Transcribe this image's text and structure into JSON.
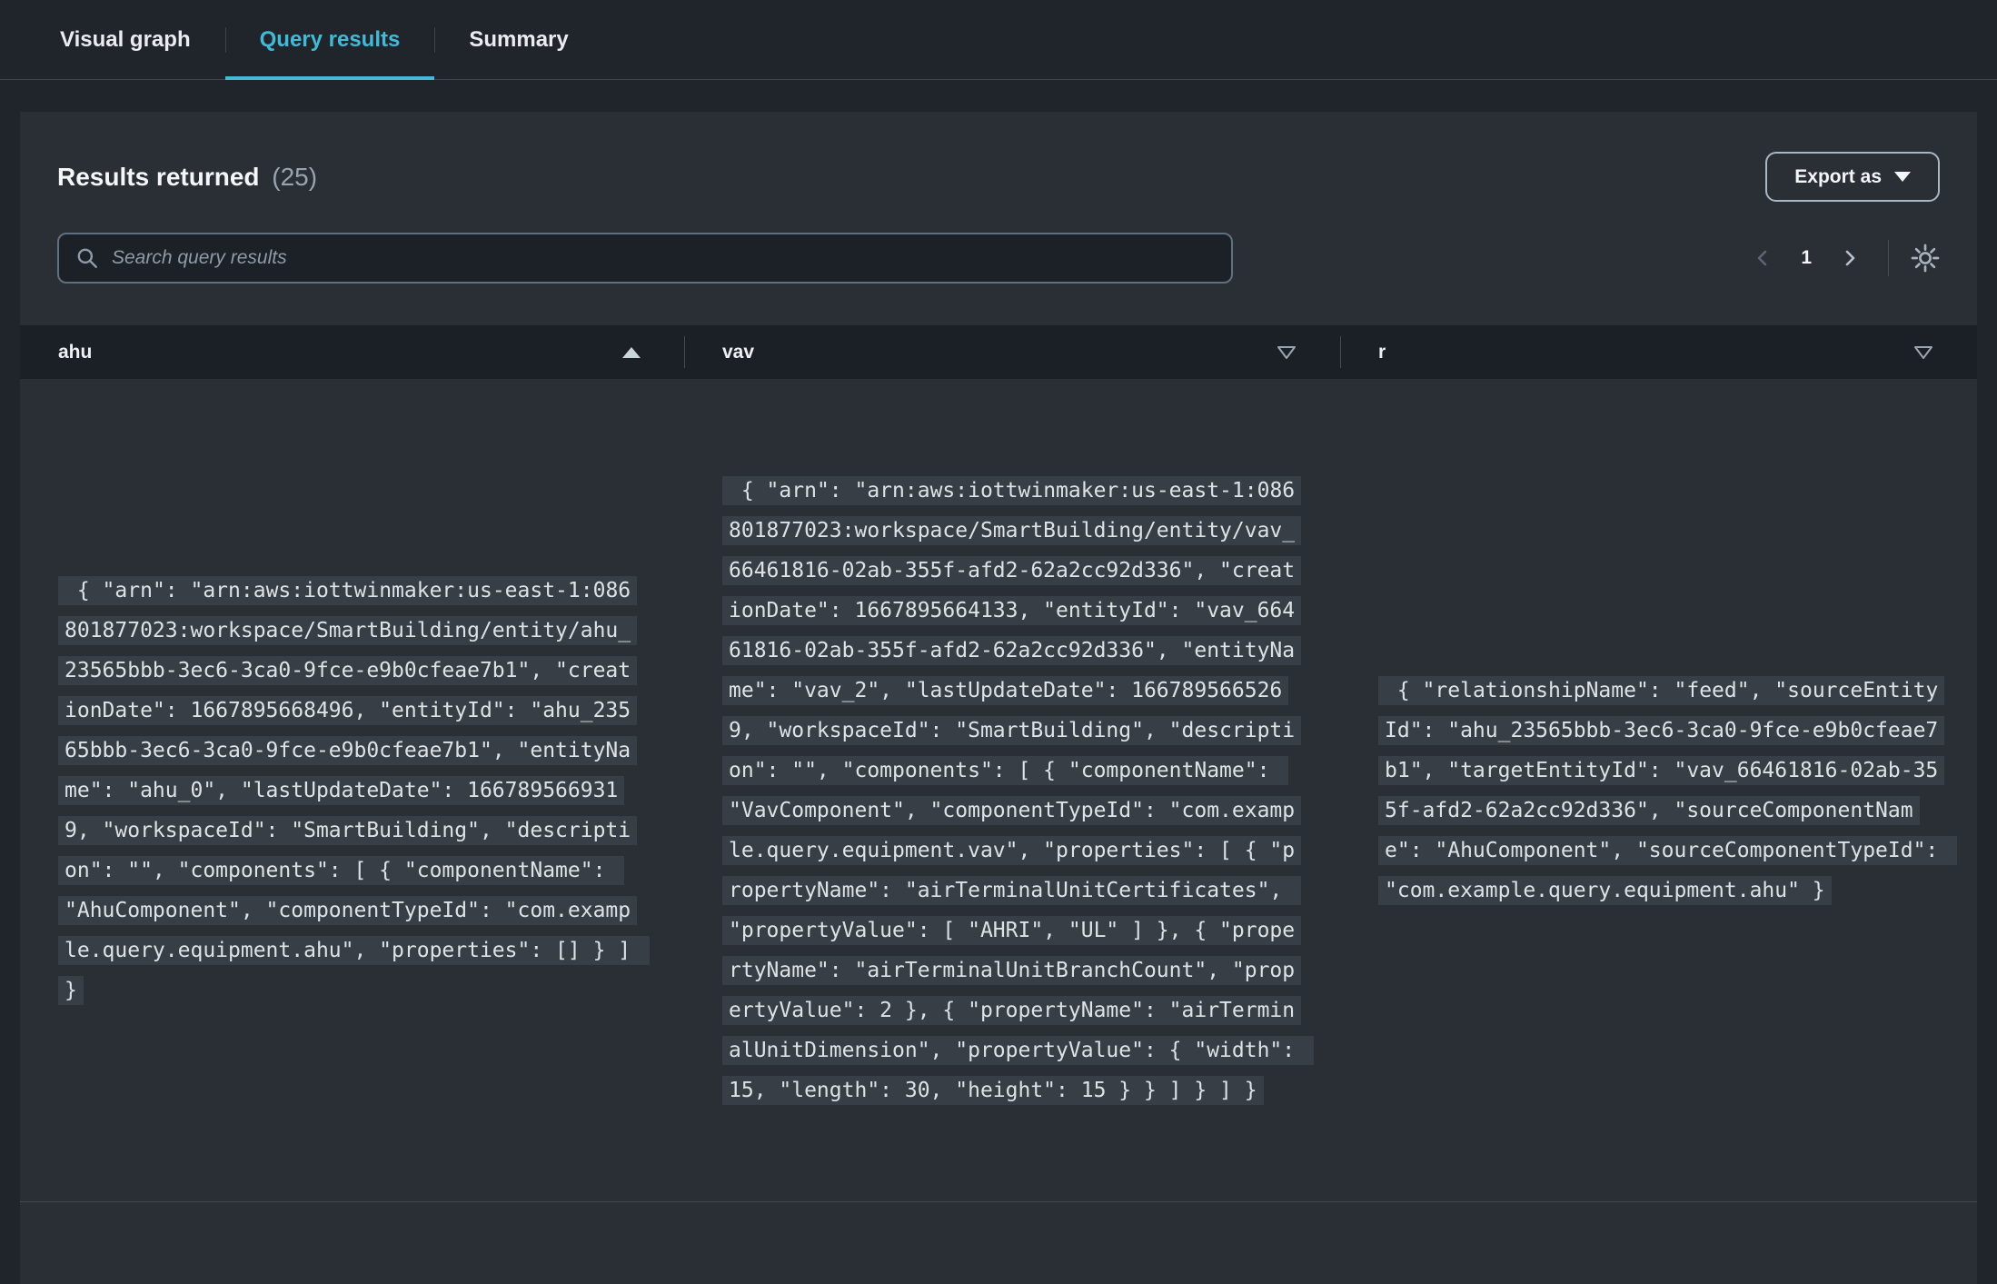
{
  "tabs": {
    "items": [
      {
        "label": "Visual graph"
      },
      {
        "label": "Query results"
      },
      {
        "label": "Summary"
      }
    ]
  },
  "panel": {
    "title": "Results returned",
    "count": "(25)",
    "export_label": "Export as",
    "search": {
      "placeholder": "Search query results"
    },
    "pagination": {
      "page": "1"
    }
  },
  "table": {
    "columns": [
      {
        "label": "ahu",
        "sort": "ascending"
      },
      {
        "label": "vav",
        "sort": "down-outline"
      },
      {
        "label": "r",
        "sort": "down-outline"
      }
    ],
    "rows": [
      {
        "ahu": " { \"arn\": \"arn:aws:iottwinmaker:us-east-1:086801877023:workspace/SmartBuilding/entity/ahu_23565bbb-3ec6-3ca0-9fce-e9b0cfeae7b1\", \"creationDate\": 1667895668496, \"entityId\": \"ahu_23565bbb-3ec6-3ca0-9fce-e9b0cfeae7b1\", \"entityName\": \"ahu_0\", \"lastUpdateDate\": 1667895669319, \"workspaceId\": \"SmartBuilding\", \"description\": \"\", \"components\": [ { \"componentName\": \"AhuComponent\", \"componentTypeId\": \"com.example.query.equipment.ahu\", \"properties\": [] } ] }",
        "vav": " { \"arn\": \"arn:aws:iottwinmaker:us-east-1:086801877023:workspace/SmartBuilding/entity/vav_66461816-02ab-355f-afd2-62a2cc92d336\", \"creationDate\": 1667895664133, \"entityId\": \"vav_66461816-02ab-355f-afd2-62a2cc92d336\", \"entityName\": \"vav_2\", \"lastUpdateDate\": 1667895665269, \"workspaceId\": \"SmartBuilding\", \"description\": \"\", \"components\": [ { \"componentName\": \"VavComponent\", \"componentTypeId\": \"com.example.query.equipment.vav\", \"properties\": [ { \"propertyName\": \"airTerminalUnitCertificates\", \"propertyValue\": [ \"AHRI\", \"UL\" ] }, { \"propertyName\": \"airTerminalUnitBranchCount\", \"propertyValue\": 2 }, { \"propertyName\": \"airTerminalUnitDimension\", \"propertyValue\": { \"width\": 15, \"length\": 30, \"height\": 15 } } ] } ] }",
        "r": " { \"relationshipName\": \"feed\", \"sourceEntityId\": \"ahu_23565bbb-3ec6-3ca0-9fce-e9b0cfeae7b1\", \"targetEntityId\": \"vav_66461816-02ab-355f-afd2-62a2cc92d336\", \"sourceComponentName\": \"AhuComponent\", \"sourceComponentTypeId\": \"com.example.query.equipment.ahu\" }"
      }
    ]
  },
  "colors": {
    "accent": "#44b9d6",
    "panel_bg": "#2a2f36",
    "header_bg": "#1b2026"
  }
}
